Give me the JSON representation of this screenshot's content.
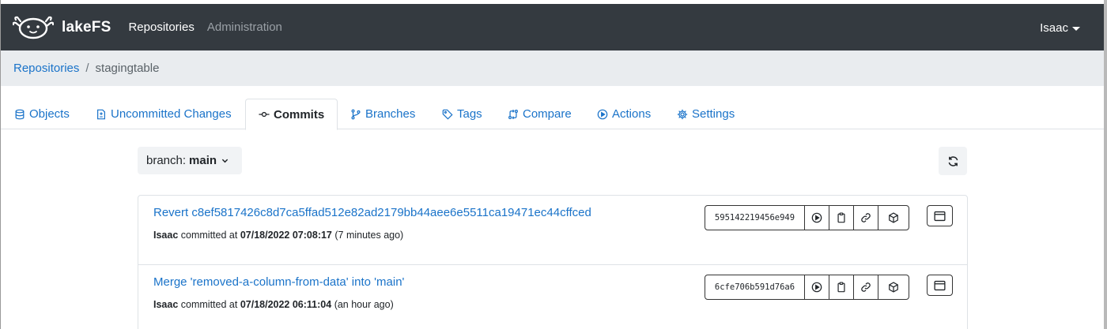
{
  "navbar": {
    "brand": "lakeFS",
    "links": [
      {
        "label": "Repositories",
        "active": true
      },
      {
        "label": "Administration",
        "active": false
      }
    ],
    "user": "Isaac"
  },
  "breadcrumb": {
    "root": "Repositories",
    "separator": "/",
    "current": "stagingtable"
  },
  "tabs": [
    {
      "label": "Objects",
      "icon": "database-icon"
    },
    {
      "label": "Uncommitted Changes",
      "icon": "file-diff-icon"
    },
    {
      "label": "Commits",
      "icon": "git-commit-icon",
      "active": true
    },
    {
      "label": "Branches",
      "icon": "git-branch-icon"
    },
    {
      "label": "Tags",
      "icon": "tag-icon"
    },
    {
      "label": "Compare",
      "icon": "git-compare-icon"
    },
    {
      "label": "Actions",
      "icon": "play-icon"
    },
    {
      "label": "Settings",
      "icon": "gear-icon"
    }
  ],
  "branch_selector": {
    "prefix": "branch:",
    "value": "main"
  },
  "commits": [
    {
      "message": "Revert c8ef5817426c8d7ca5ffad512e82ad2179bb44aee6e5511ca19471ec44cffced",
      "committer": "Isaac",
      "verb": "committed at",
      "timestamp": "07/18/2022 07:08:17",
      "relative": "(7 minutes ago)",
      "sha": "595142219456e949"
    },
    {
      "message": "Merge 'removed-a-column-from-data' into 'main'",
      "committer": "Isaac",
      "verb": "committed at",
      "timestamp": "07/18/2022 06:11:04",
      "relative": "(an hour ago)",
      "sha": "6cfe706b591d76a6"
    }
  ],
  "colors": {
    "navbar": "#343a40",
    "link": "#1a73c9",
    "breadcrumb_bg": "#e9ecef"
  }
}
